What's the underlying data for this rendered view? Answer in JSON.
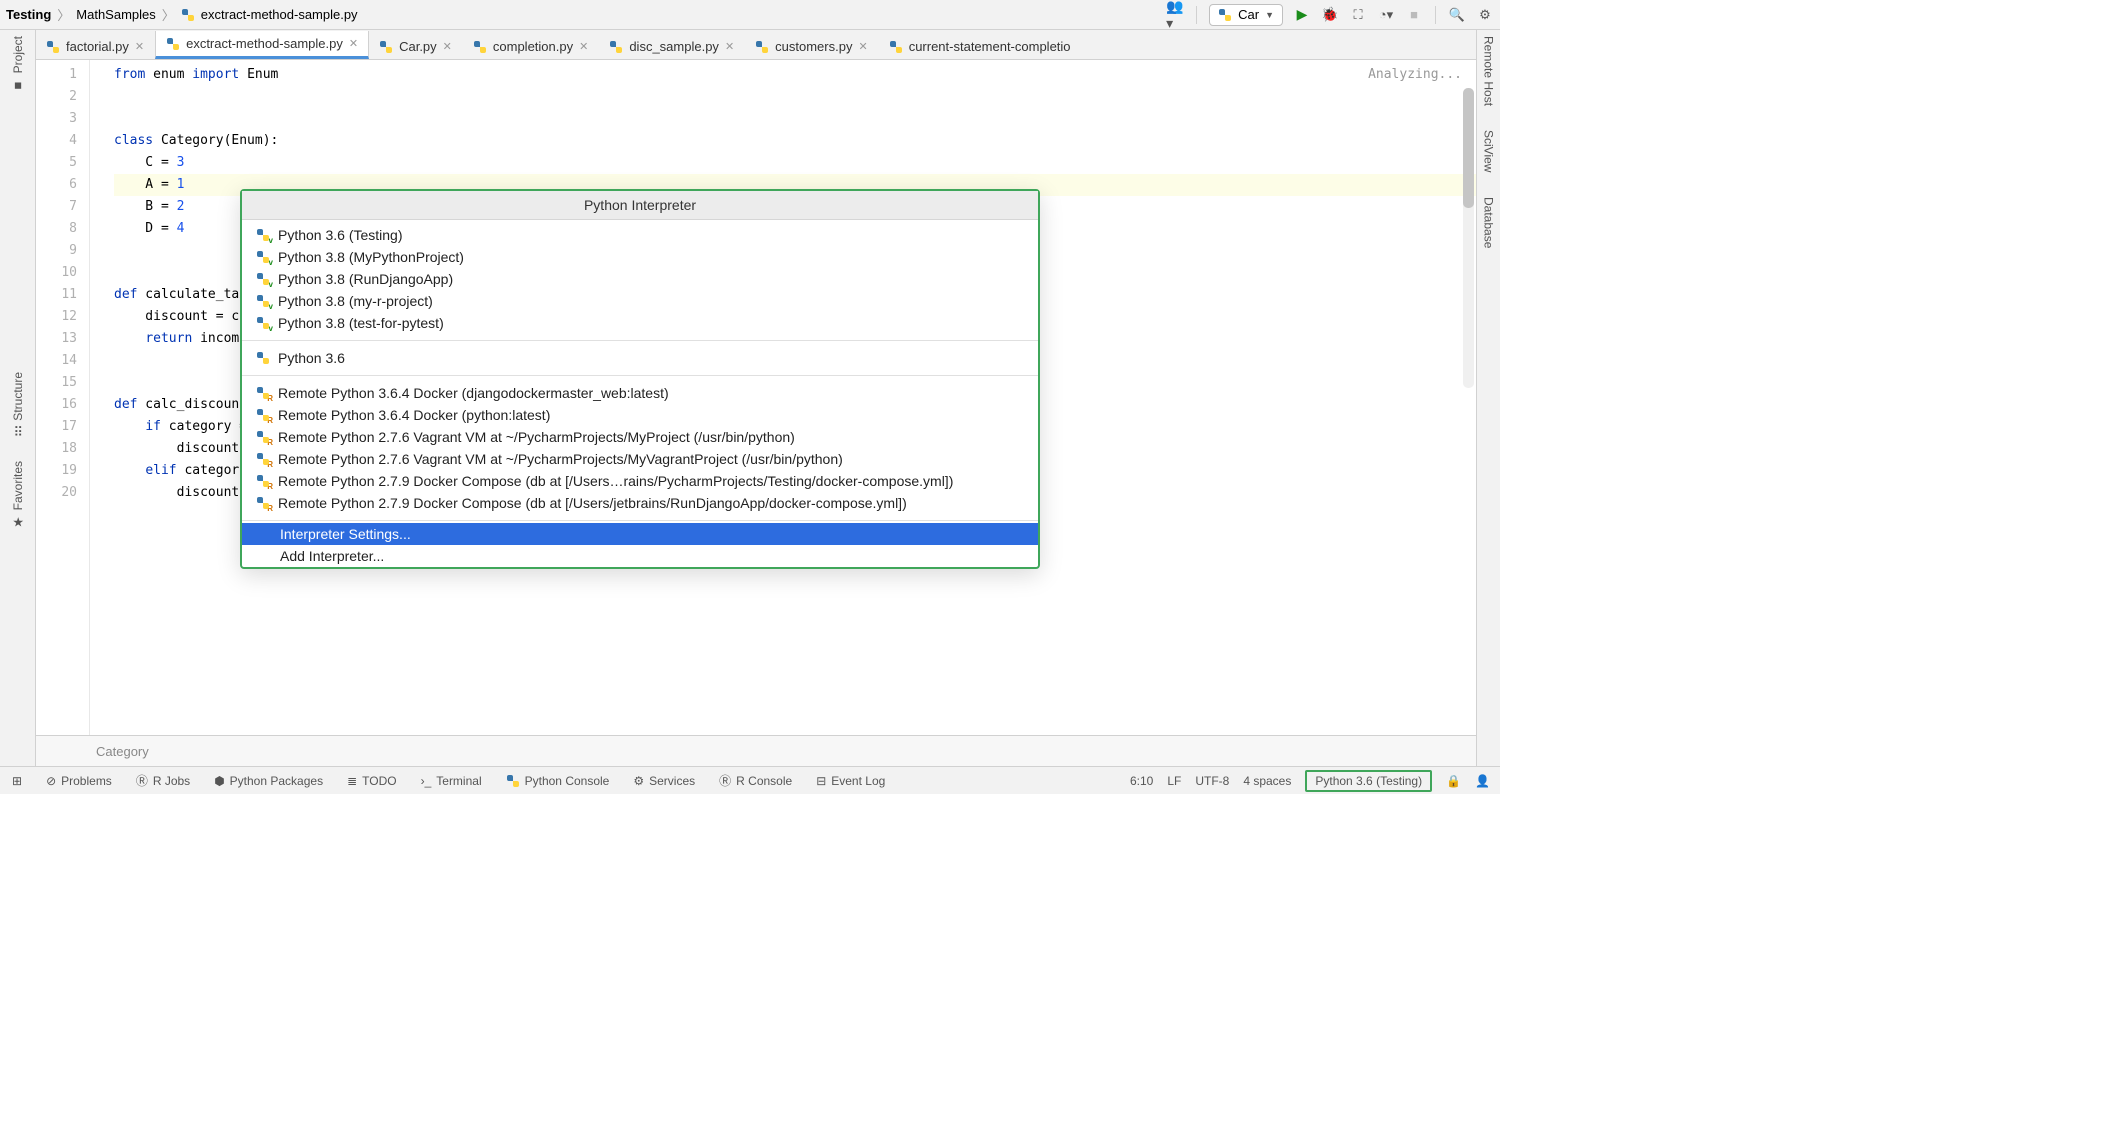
{
  "breadcrumb": {
    "root": "Testing",
    "mid": "MathSamples",
    "file": "exctract-method-sample.py"
  },
  "runConfig": {
    "label": "Car"
  },
  "tabs": [
    {
      "label": "factorial.py",
      "active": false
    },
    {
      "label": "exctract-method-sample.py",
      "active": true
    },
    {
      "label": "Car.py",
      "active": false
    },
    {
      "label": "completion.py",
      "active": false
    },
    {
      "label": "disc_sample.py",
      "active": false
    },
    {
      "label": "customers.py",
      "active": false
    },
    {
      "label": "current-statement-completio",
      "active": false
    }
  ],
  "analyzing": "Analyzing...",
  "leftRail": [
    {
      "label": "Project",
      "icon": "■"
    },
    {
      "label": "Structure",
      "icon": "⠿"
    },
    {
      "label": "Favorites",
      "icon": "★"
    }
  ],
  "rightRail": [
    {
      "label": "Remote Host",
      "icon": "≣"
    },
    {
      "label": "SciView",
      "icon": "≣"
    },
    {
      "label": "Database",
      "icon": "≣"
    }
  ],
  "gutterLines": [
    "1",
    "2",
    "3",
    "4",
    "5",
    "6",
    "7",
    "8",
    "9",
    "10",
    "11",
    "12",
    "13",
    "14",
    "15",
    "16",
    "17",
    "18",
    "19",
    "20"
  ],
  "code": {
    "l1_1": "from",
    "l1_2": " enum ",
    "l1_3": "import",
    "l1_4": " Enum",
    "l4_1": "class",
    "l4_2": " Category(Enum):",
    "l5_1": "    C = ",
    "l5_2": "3",
    "l6_1": "    A = ",
    "l6_2": "1",
    "l7_1": "    B = ",
    "l7_2": "2",
    "l8_1": "    D = ",
    "l8_2": "4",
    "l11_1": "def",
    "l11_2": " calculate_tax(c",
    "l12_1": "    discount = calc",
    "l13_1": "    ",
    "l13_2": "return",
    "l13_3": " income *",
    "l16_1": "def",
    "l16_2": " calc_discount(c",
    "l17_1": "    ",
    "l17_2": "if",
    "l17_3": " category == ",
    "l18_1": "        discount = ",
    "l19_1": "    ",
    "l19_2": "elif",
    "l19_3": " category =",
    "l20_1": "        discount = "
  },
  "crumb": "Category",
  "popup": {
    "title": "Python Interpreter",
    "group1": [
      {
        "label": "Python 3.6 (Testing)",
        "badge": "v"
      },
      {
        "label": "Python 3.8 (MyPythonProject)",
        "badge": "v"
      },
      {
        "label": "Python 3.8 (RunDjangoApp)",
        "badge": "v"
      },
      {
        "label": "Python 3.8 (my-r-project)",
        "badge": "v"
      },
      {
        "label": "Python 3.8 (test-for-pytest)",
        "badge": "v"
      }
    ],
    "group2": [
      {
        "label": "Python 3.6",
        "badge": ""
      }
    ],
    "group3": [
      {
        "label": "Remote Python 3.6.4 Docker (djangodockermaster_web:latest)",
        "badge": "r"
      },
      {
        "label": "Remote Python 3.6.4 Docker (python:latest)",
        "badge": "r"
      },
      {
        "label": "Remote Python 2.7.6 Vagrant VM at ~/PycharmProjects/MyProject (/usr/bin/python)",
        "badge": "r"
      },
      {
        "label": "Remote Python 2.7.6 Vagrant VM at ~/PycharmProjects/MyVagrantProject (/usr/bin/python)",
        "badge": "r"
      },
      {
        "label": "Remote Python 2.7.9 Docker Compose (db at [/Users…rains/PycharmProjects/Testing/docker-compose.yml])",
        "badge": "r"
      },
      {
        "label": "Remote Python 2.7.9 Docker Compose (db at [/Users/jetbrains/RunDjangoApp/docker-compose.yml])",
        "badge": "r"
      }
    ],
    "actions": {
      "settings": "Interpreter Settings...",
      "add": "Add Interpreter..."
    }
  },
  "bottomTools": [
    {
      "icon": "⊘",
      "label": "Problems"
    },
    {
      "icon": "Ⓡ",
      "label": "R Jobs"
    },
    {
      "icon": "⬢",
      "label": "Python Packages"
    },
    {
      "icon": "≣",
      "label": "TODO"
    },
    {
      "icon": ">_",
      "label": "Terminal"
    },
    {
      "icon": "🐍",
      "label": "Python Console"
    },
    {
      "icon": "⚙",
      "label": "Services"
    },
    {
      "icon": "Ⓡ",
      "label": "R Console"
    },
    {
      "icon": "⊟",
      "label": "Event Log"
    }
  ],
  "status": {
    "caret": "6:10",
    "lineSep": "LF",
    "encoding": "UTF-8",
    "indent": "4 spaces",
    "interpreter": "Python 3.6 (Testing)"
  }
}
